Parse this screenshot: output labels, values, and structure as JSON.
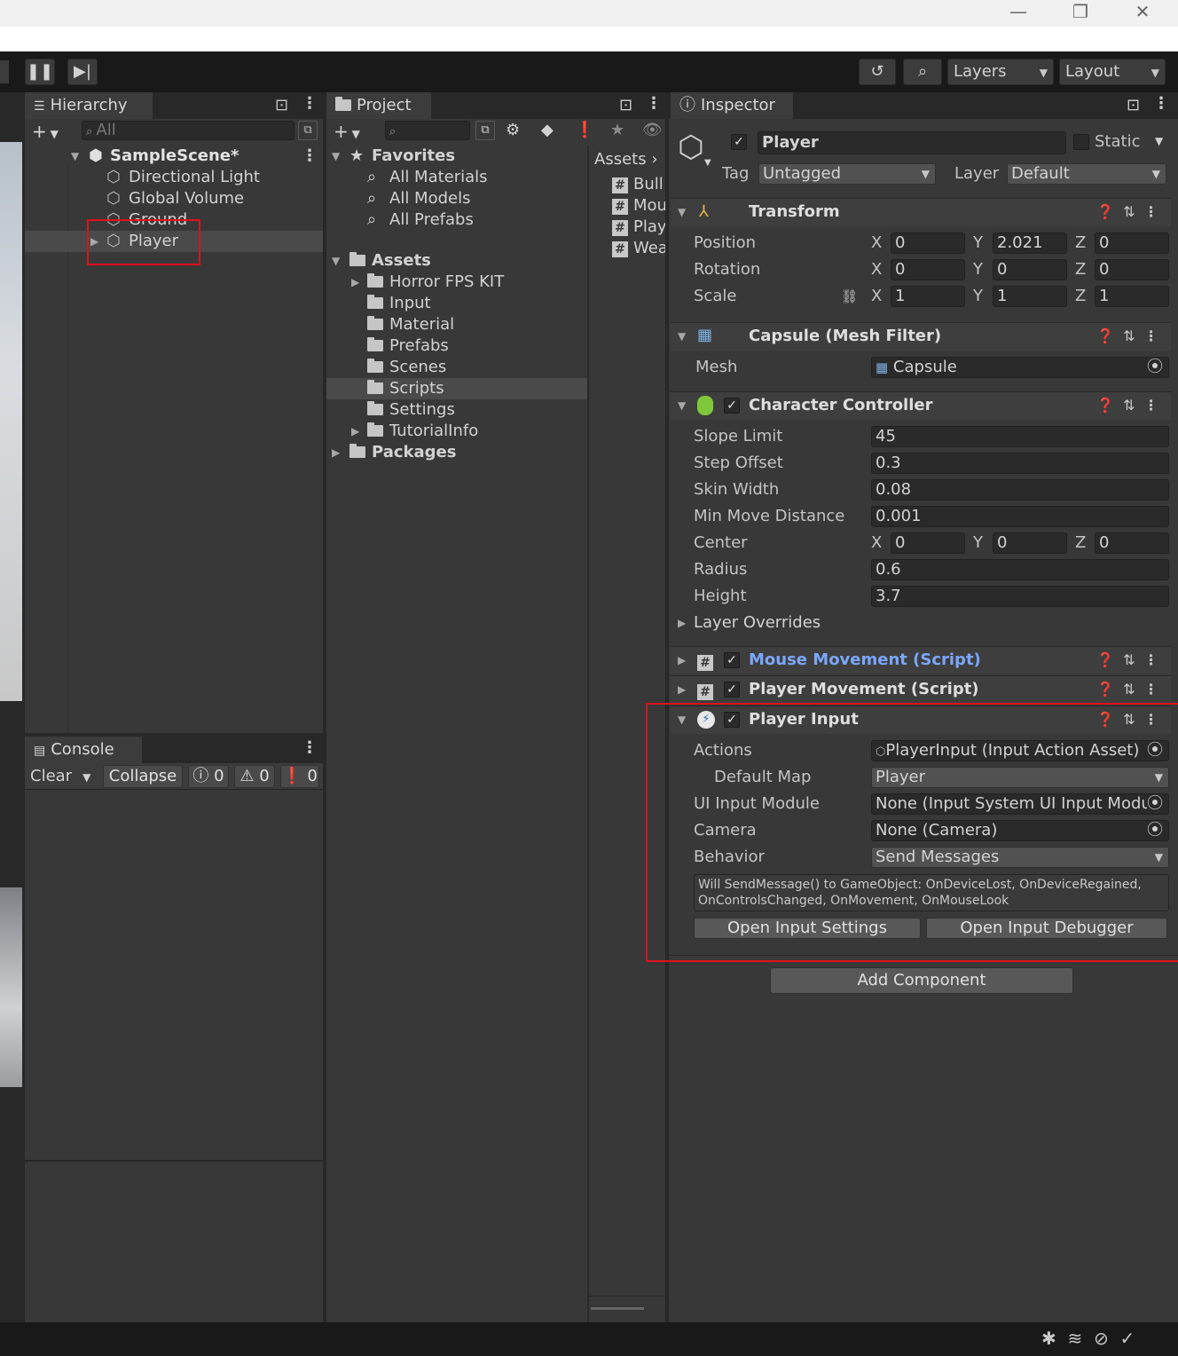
{
  "window": {
    "minimize": "—",
    "restore": "❐",
    "close": "✕"
  },
  "toolbar": {
    "layers": "Layers",
    "layout": "Layout"
  },
  "hierarchy": {
    "tab": "Hierarchy",
    "search_placeholder": "All",
    "scene": "SampleScene*",
    "items": [
      "Directional Light",
      "Global Volume",
      "Ground",
      "Player"
    ]
  },
  "console": {
    "tab": "Console",
    "clear": "Clear",
    "collapse": "Collapse",
    "info_count": "0",
    "warn_count": "0",
    "error_count": "0"
  },
  "project": {
    "tab": "Project",
    "favorites": "Favorites",
    "favorite_items": [
      "All Materials",
      "All Models",
      "All Prefabs"
    ],
    "assets": "Assets",
    "asset_folders": [
      "Horror FPS KIT",
      "Input",
      "Material",
      "Prefabs",
      "Scenes",
      "Scripts",
      "Settings",
      "TutorialInfo"
    ],
    "packages": "Packages",
    "breadcrumb": "Assets",
    "files": [
      "Bull",
      "Mou",
      "Play",
      "Wea"
    ]
  },
  "inspector": {
    "tab": "Inspector",
    "object_name": "Player",
    "static_label": "Static",
    "tag_label": "Tag",
    "tag_value": "Untagged",
    "layer_label": "Layer",
    "layer_value": "Default",
    "transform": {
      "title": "Transform",
      "position_label": "Position",
      "position": [
        "0",
        "2.021",
        "0"
      ],
      "rotation_label": "Rotation",
      "rotation": [
        "0",
        "0",
        "0"
      ],
      "scale_label": "Scale",
      "scale": [
        "1",
        "1",
        "1"
      ]
    },
    "mesh_filter": {
      "title": "Capsule (Mesh Filter)",
      "mesh_label": "Mesh",
      "mesh_value": "Capsule"
    },
    "character_controller": {
      "title": "Character Controller",
      "slope_label": "Slope Limit",
      "slope": "45",
      "step_label": "Step Offset",
      "step": "0.3",
      "skin_label": "Skin Width",
      "skin": "0.08",
      "minmove_label": "Min Move Distance",
      "minmove": "0.001",
      "center_label": "Center",
      "center": [
        "0",
        "0",
        "0"
      ],
      "radius_label": "Radius",
      "radius": "0.6",
      "height_label": "Height",
      "height": "3.7",
      "layer_overrides": "Layer Overrides"
    },
    "mouse_movement": {
      "title": "Mouse Movement (Script)"
    },
    "player_movement": {
      "title": "Player Movement (Script)"
    },
    "player_input": {
      "title": "Player Input",
      "actions_label": "Actions",
      "actions_value": "PlayerInput (Input Action Asset)",
      "defaultmap_label": "Default Map",
      "defaultmap_value": "Player",
      "uimodule_label": "UI Input Module",
      "uimodule_value": "None (Input System UI Input Modul",
      "camera_label": "Camera",
      "camera_value": "None (Camera)",
      "behavior_label": "Behavior",
      "behavior_value": "Send Messages",
      "info_line1": "Will SendMessage() to GameObject: OnDeviceLost, OnDeviceRegained,",
      "info_line2": "OnControlsChanged, OnMovement, OnMouseLook",
      "open_settings": "Open Input Settings",
      "open_debugger": "Open Input Debugger"
    },
    "add_component": "Add Component"
  },
  "axis": {
    "x": "X",
    "y": "Y",
    "z": "Z"
  },
  "colors": {
    "highlight": "#e0101c",
    "link_blue": "#7ba7ff",
    "panel": "#383838"
  }
}
